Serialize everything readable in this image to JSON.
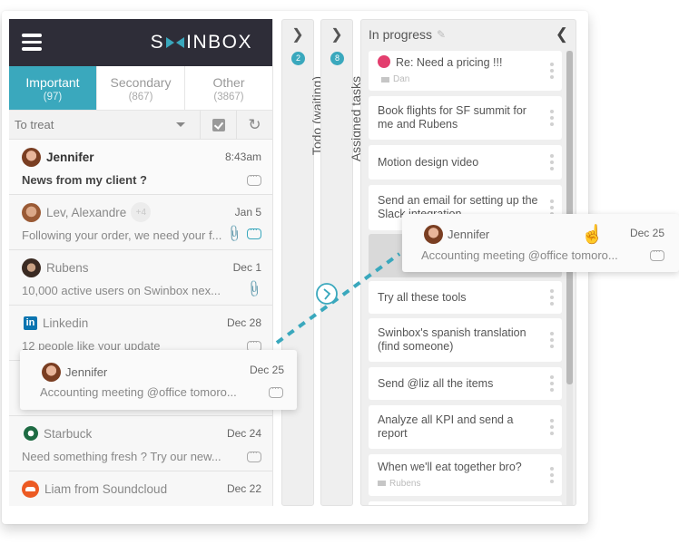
{
  "app": {
    "logo": "SWINBOX",
    "logo_left": "S",
    "logo_right": "INBOX",
    "accent_color": "#3aa8bd"
  },
  "inbox": {
    "tabs": [
      {
        "label": "Important",
        "count": "(97)",
        "active": true
      },
      {
        "label": "Secondary",
        "count": "(867)",
        "active": false
      },
      {
        "label": "Other",
        "count": "(3867)",
        "active": false
      }
    ],
    "filter": {
      "selected": "To treat"
    },
    "mails": [
      {
        "sender": "Jennifer",
        "date": "8:43am",
        "preview": "News from my client ?",
        "icon": "avatar-jennifer",
        "unread": true
      },
      {
        "sender": "Lev, Alexandre",
        "extra": "+4",
        "date": "Jan 5",
        "preview": "Following your order, we need your f...",
        "icon": "avatar-lev",
        "attachment": true
      },
      {
        "sender": "Rubens",
        "date": "Dec 1",
        "preview": "10,000 active users on Swinbox nex...",
        "icon": "avatar-rubens",
        "attachment": true
      },
      {
        "sender": "Linkedin",
        "date": "Dec 28",
        "preview": "12 people like your update",
        "icon": "linkedin-logo"
      },
      {
        "sender": "Starbuck",
        "date": "Dec 24",
        "preview": "Need something fresh ? Try our new...",
        "icon": "starbucks-logo"
      },
      {
        "sender": "Liam from Soundcloud",
        "date": "Dec 22",
        "preview": "",
        "icon": "soundcloud-logo"
      }
    ]
  },
  "columns": [
    {
      "label": "Todo (waiting)",
      "count": "2"
    },
    {
      "label": "Assigned tasks",
      "count": "8"
    }
  ],
  "in_progress": {
    "title": "In progress",
    "tasks": [
      {
        "title": "Re: Need a pricing !!!",
        "meta": "Dan"
      },
      {
        "title": "Book flights for SF summit for me and Rubens"
      },
      {
        "title": "Motion design video"
      },
      {
        "title": "Send an email for setting up the Slack integration"
      },
      {
        "title": ""
      },
      {
        "title": "Try all these tools"
      },
      {
        "title": "Swinbox's spanish translation (find someone)"
      },
      {
        "title": "Send @liz all the items"
      },
      {
        "title": "Analyze all KPI and send a report"
      },
      {
        "title": "When we'll eat together bro?",
        "meta": "Rubens"
      }
    ]
  },
  "drag_card": {
    "sender": "Jennifer",
    "date": "Dec 25",
    "preview": "Accounting meeting @office tomoro..."
  }
}
